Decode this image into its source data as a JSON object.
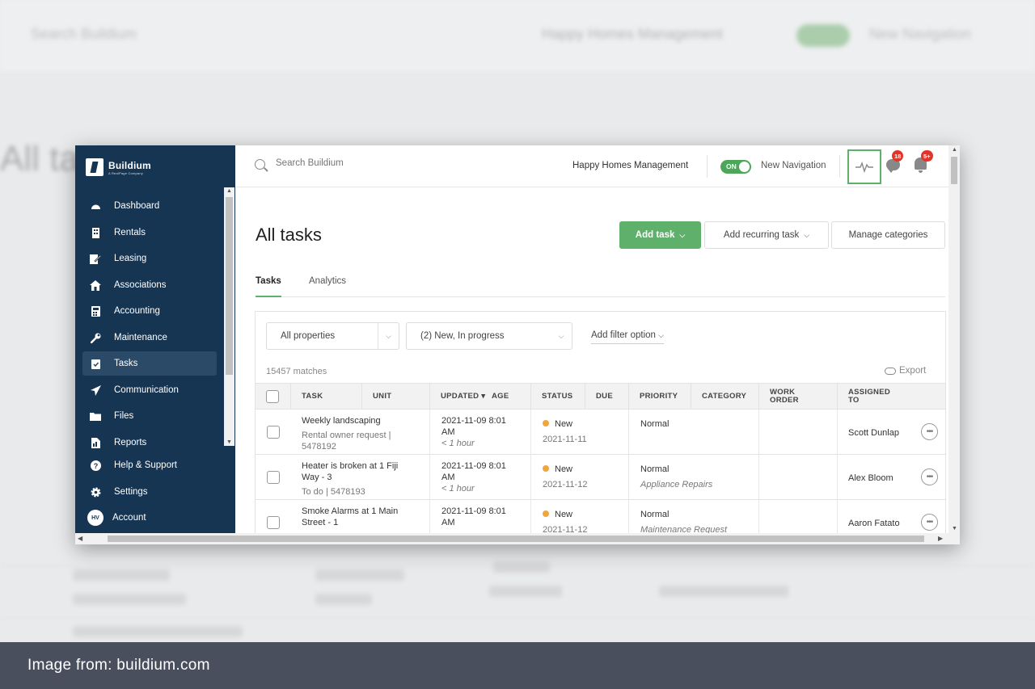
{
  "background": {
    "search_placeholder": "Search Buildium",
    "company": "Happy Homes Management",
    "new_navigation": "New Navigation",
    "title": "All ta"
  },
  "sidebar": {
    "brand": "Buildium",
    "brand_sub": "A RealPage Company",
    "items": [
      {
        "label": "Dashboard",
        "icon": "dashboard-icon"
      },
      {
        "label": "Rentals",
        "icon": "building-icon"
      },
      {
        "label": "Leasing",
        "icon": "leasing-icon"
      },
      {
        "label": "Associations",
        "icon": "house-icon"
      },
      {
        "label": "Accounting",
        "icon": "calculator-icon"
      },
      {
        "label": "Maintenance",
        "icon": "wrench-icon"
      },
      {
        "label": "Tasks",
        "icon": "clipboard-check-icon",
        "active": true
      },
      {
        "label": "Communication",
        "icon": "paper-plane-icon"
      },
      {
        "label": "Files",
        "icon": "folder-icon"
      },
      {
        "label": "Reports",
        "icon": "report-icon"
      },
      {
        "label": "Help & Support",
        "icon": "help-icon"
      },
      {
        "label": "Settings",
        "icon": "gear-icon"
      },
      {
        "label": "Account",
        "icon": "avatar",
        "avatar_initials": "HV"
      }
    ]
  },
  "topbar": {
    "search_placeholder": "Search Buildium",
    "company": "Happy Homes Management",
    "toggle_label": "ON",
    "new_navigation": "New Navigation",
    "chat_badge": "18",
    "notification_badge": "5+"
  },
  "main": {
    "title": "All tasks",
    "add_task": "Add task",
    "add_recurring_task": "Add recurring task",
    "manage_categories": "Manage categories",
    "tabs": [
      {
        "label": "Tasks",
        "active": true
      },
      {
        "label": "Analytics",
        "active": false
      }
    ],
    "filters": {
      "properties": "All properties",
      "status": "(2) New, In progress",
      "add_filter": "Add filter option"
    },
    "matches": "15457 matches",
    "export": "Export",
    "columns": [
      "TASK",
      "UNIT",
      "UPDATED",
      "AGE",
      "STATUS",
      "DUE",
      "PRIORITY",
      "CATEGORY",
      "WORK ORDER",
      "ASSIGNED TO"
    ],
    "rows": [
      {
        "task": "Weekly landscaping",
        "task_sub": "Rental owner request | 5478192",
        "updated": "2021-11-09 8:01 AM",
        "age": "< 1 hour",
        "status": "New",
        "status_date": "2021-11-11",
        "priority": "Normal",
        "category": "",
        "assigned": "Scott Dunlap"
      },
      {
        "task": "Heater is broken at 1 Fiji Way - 3",
        "task_sub": "To do | 5478193",
        "updated": "2021-11-09 8:01 AM",
        "age": "< 1 hour",
        "status": "New",
        "status_date": "2021-11-12",
        "priority": "Normal",
        "category": "Appliance Repairs",
        "assigned": "Alex Bloom"
      },
      {
        "task": "Smoke Alarms at 1 Main Street - 1",
        "task_sub": "",
        "updated": "2021-11-09 8:01 AM",
        "age": "",
        "status": "New",
        "status_date": "2021-11-12",
        "priority": "Normal",
        "category": "Maintenance Request",
        "assigned": "Aaron Fatato"
      }
    ]
  },
  "caption": "Image from: buildium.com",
  "colors": {
    "sidebar": "#163553",
    "accent_green": "#5fb06a",
    "badge_red": "#e1352b",
    "status_new": "#f0a540"
  }
}
